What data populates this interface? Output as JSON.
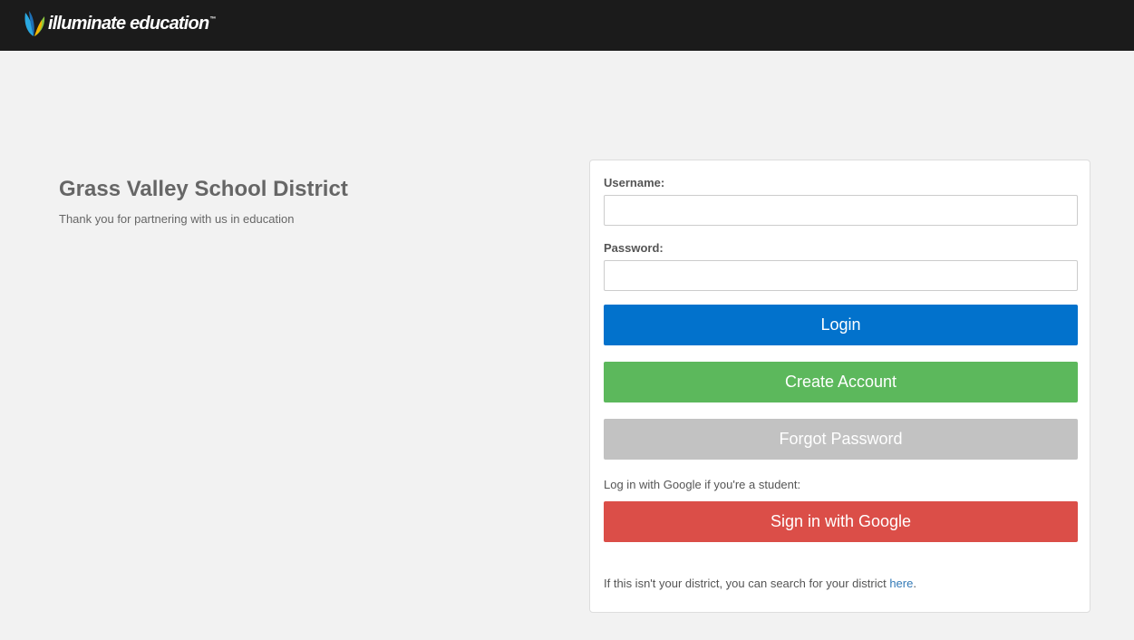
{
  "header": {
    "logo_text": "illuminate education",
    "logo_tm": "™",
    "background_color": "#1b1b1b"
  },
  "district": {
    "name": "Grass Valley School District",
    "tagline": "Thank you for partnering with us in education"
  },
  "login_form": {
    "username_label": "Username:",
    "username_value": "",
    "password_label": "Password:",
    "password_value": "",
    "login_button": "Login",
    "create_account_button": "Create Account",
    "forgot_password_button": "Forgot Password",
    "google_prompt": "Log in with Google if you're a student:",
    "google_button": "Sign in with Google",
    "footer_text": "If this isn't your district, you can search for your district ",
    "footer_link": "here",
    "footer_end": "."
  },
  "colors": {
    "login": "#0272cc",
    "create_account": "#5cb85c",
    "forgot_password": "#c2c2c2",
    "google": "#db4e48",
    "link": "#337ab7"
  }
}
